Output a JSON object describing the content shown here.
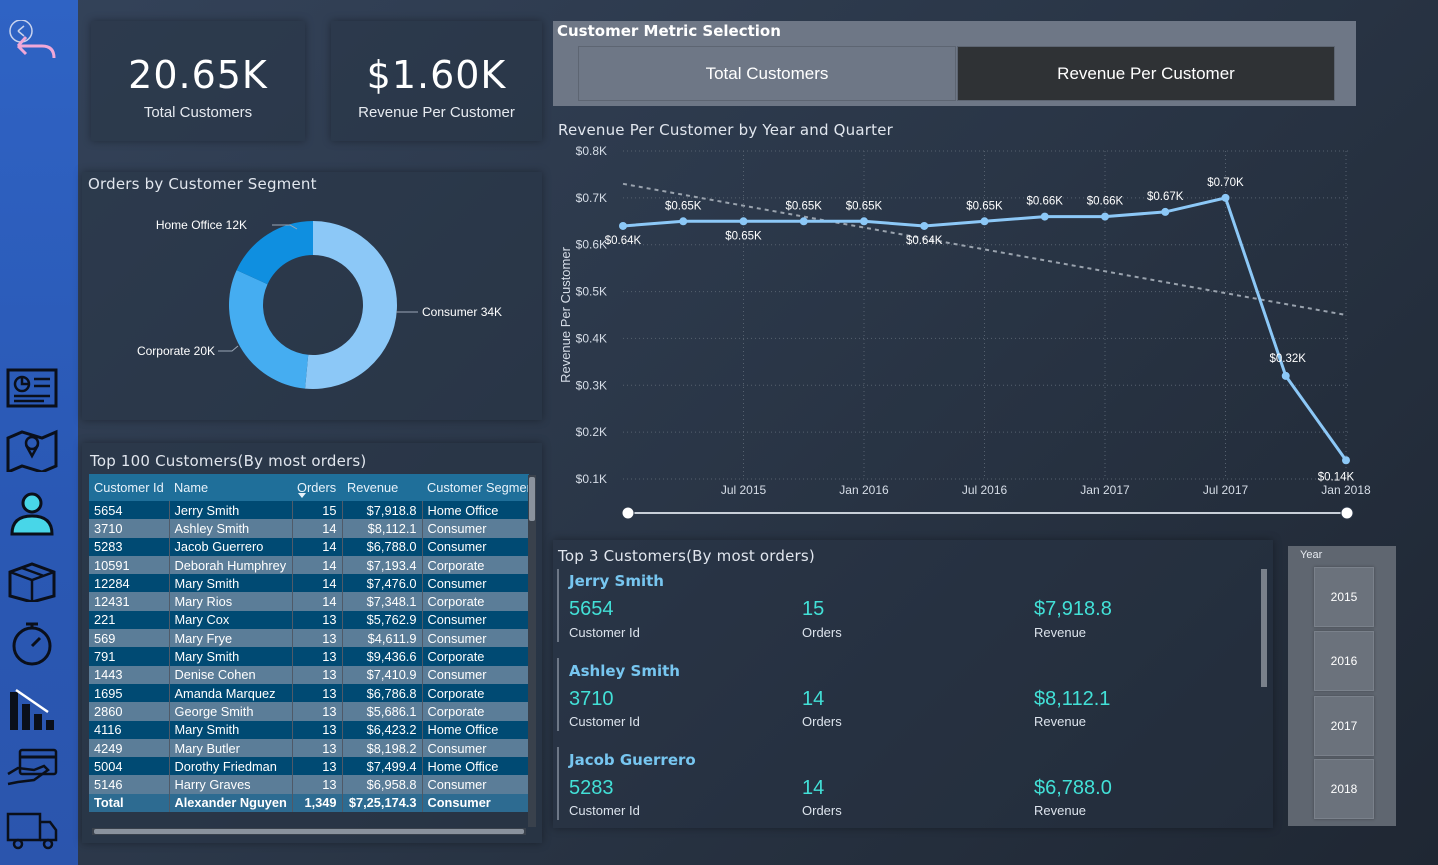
{
  "kpis": [
    {
      "value": "20.65K",
      "label": "Total Customers"
    },
    {
      "value": "$1.60K",
      "label": "Revenue Per Customer"
    }
  ],
  "metric_selection": {
    "title": "Customer Metric Selection",
    "options": [
      "Total Customers",
      "Revenue Per Customer"
    ],
    "selected": "Revenue Per Customer"
  },
  "segment_chart": {
    "title": "Orders by Customer Segment",
    "labels": [
      "Home Office 12K",
      "Consumer 34K",
      "Corporate 20K"
    ]
  },
  "line_chart": {
    "title": "Revenue Per Customer by Year and Quarter",
    "ylabel": "Revenue Per Customer",
    "y_ticks": [
      "$0.8K",
      "$0.7K",
      "$0.6K",
      "$0.5K",
      "$0.4K",
      "$0.3K",
      "$0.2K",
      "$0.1K"
    ],
    "x_ticks": [
      "Jul 2015",
      "Jan 2016",
      "Jul 2016",
      "Jan 2017",
      "Jul 2017",
      "Jan 2018"
    ],
    "point_labels": [
      "$0.64K",
      "$0.65K",
      "$0.65K",
      "$0.65K",
      "$0.65K",
      "$0.64K",
      "$0.65K",
      "$0.66K",
      "$0.66K",
      "$0.67K",
      "$0.70K",
      "$0.32K",
      "$0.14K"
    ]
  },
  "chart_data": [
    {
      "type": "pie",
      "title": "Orders by Customer Segment",
      "labels": [
        "Consumer",
        "Corporate",
        "Home Office"
      ],
      "values": [
        34,
        20,
        12
      ],
      "unit": "K",
      "colors": [
        "#8cc8f7",
        "#45adf1",
        "#0f8fe0"
      ]
    },
    {
      "type": "line",
      "title": "Revenue Per Customer by Year and Quarter",
      "ylabel": "Revenue Per Customer",
      "x": [
        "2015 Q1",
        "2015 Q2",
        "2015 Q3",
        "2015 Q4",
        "2016 Q1",
        "2016 Q2",
        "2016 Q3",
        "2016 Q4",
        "2017 Q1",
        "2017 Q2",
        "2017 Q3",
        "2017 Q4",
        "2018 Q1"
      ],
      "series": [
        {
          "values": [
            0.64,
            0.65,
            0.65,
            0.65,
            0.65,
            0.64,
            0.65,
            0.66,
            0.66,
            0.67,
            0.7,
            0.32,
            0.14
          ]
        }
      ],
      "trend_line": [
        0.73,
        0.45
      ],
      "ylim": [
        0.1,
        0.8
      ],
      "y_unit": "K",
      "grid": true
    }
  ],
  "table": {
    "title": "Top 100 Customers(By most orders)",
    "columns": [
      "Customer Id",
      "Name",
      "Orders",
      "Revenue",
      "Customer Segment"
    ],
    "rows": [
      [
        "5654",
        "Jerry Smith",
        "15",
        "$7,918.8",
        "Home Office"
      ],
      [
        "3710",
        "Ashley Smith",
        "14",
        "$8,112.1",
        "Consumer"
      ],
      [
        "5283",
        "Jacob Guerrero",
        "14",
        "$6,788.0",
        "Consumer"
      ],
      [
        "10591",
        "Deborah Humphrey",
        "14",
        "$7,193.4",
        "Corporate"
      ],
      [
        "12284",
        "Mary Smith",
        "14",
        "$7,476.0",
        "Consumer"
      ],
      [
        "12431",
        "Mary Rios",
        "14",
        "$7,348.1",
        "Corporate"
      ],
      [
        "221",
        "Mary Cox",
        "13",
        "$5,762.9",
        "Consumer"
      ],
      [
        "569",
        "Mary Frye",
        "13",
        "$4,611.9",
        "Consumer"
      ],
      [
        "791",
        "Mary Smith",
        "13",
        "$9,436.6",
        "Corporate"
      ],
      [
        "1443",
        "Denise Cohen",
        "13",
        "$7,410.9",
        "Consumer"
      ],
      [
        "1695",
        "Amanda Marquez",
        "13",
        "$6,786.8",
        "Corporate"
      ],
      [
        "2860",
        "George Smith",
        "13",
        "$5,686.1",
        "Corporate"
      ],
      [
        "4116",
        "Mary Smith",
        "13",
        "$6,423.2",
        "Home Office"
      ],
      [
        "4249",
        "Mary Butler",
        "13",
        "$8,198.2",
        "Consumer"
      ],
      [
        "5004",
        "Dorothy Friedman",
        "13",
        "$7,499.4",
        "Home Office"
      ],
      [
        "5146",
        "Harry Graves",
        "13",
        "$6,958.8",
        "Consumer"
      ]
    ],
    "total": [
      "Total",
      "Alexander Nguyen",
      "1,349",
      "$7,25,174.3",
      "Consumer"
    ]
  },
  "top3": {
    "title": "Top 3 Customers(By most orders)",
    "customers": [
      {
        "name": "Jerry Smith",
        "id": "5654",
        "orders": "15",
        "revenue": "$7,918.8"
      },
      {
        "name": "Ashley Smith",
        "id": "3710",
        "orders": "14",
        "revenue": "$8,112.1"
      },
      {
        "name": "Jacob Guerrero",
        "id": "5283",
        "orders": "14",
        "revenue": "$6,788.0"
      }
    ],
    "labels": {
      "id": "Customer Id",
      "orders": "Orders",
      "revenue": "Revenue"
    }
  },
  "year_slicer": {
    "title": "Year",
    "years": [
      "2015",
      "2016",
      "2017",
      "2018"
    ]
  },
  "nav": {
    "icons": [
      "back-arrow-icon",
      "dashboard-icon",
      "map-icon",
      "customer-icon",
      "product-box-icon",
      "stopwatch-icon",
      "decline-chart-icon",
      "payment-icon",
      "delivery-truck-icon"
    ]
  }
}
